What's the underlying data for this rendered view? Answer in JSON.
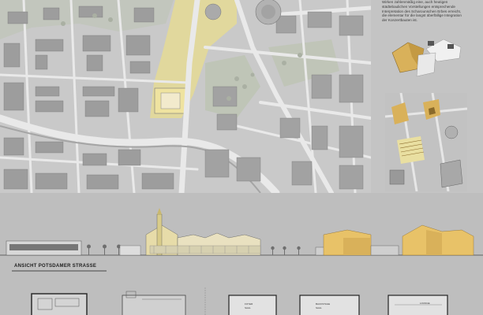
{
  "description_text": "Wirken zahlenmäßig eine, auch heutigen städtebaulichen Vorstellungen entsprechende Interpretation des Scharounschen Erbes erreicht, die elementar für die langst überfällige Integration der Konzertbauten ist.",
  "elevation_label": "ANSICHT POTSDAMER STRASSE",
  "plan_labels": [
    "FOYER",
    "SAAL",
    "BACKSTAGE",
    "SAAL",
    "LOUNGE"
  ],
  "colors": {
    "highlight": "#e8dc8e",
    "gold": "#d9b15a",
    "map_bg": "#c9c9c9",
    "building": "#9a9a9a",
    "road": "#e6e6e6",
    "green": "#b9c2a9"
  }
}
